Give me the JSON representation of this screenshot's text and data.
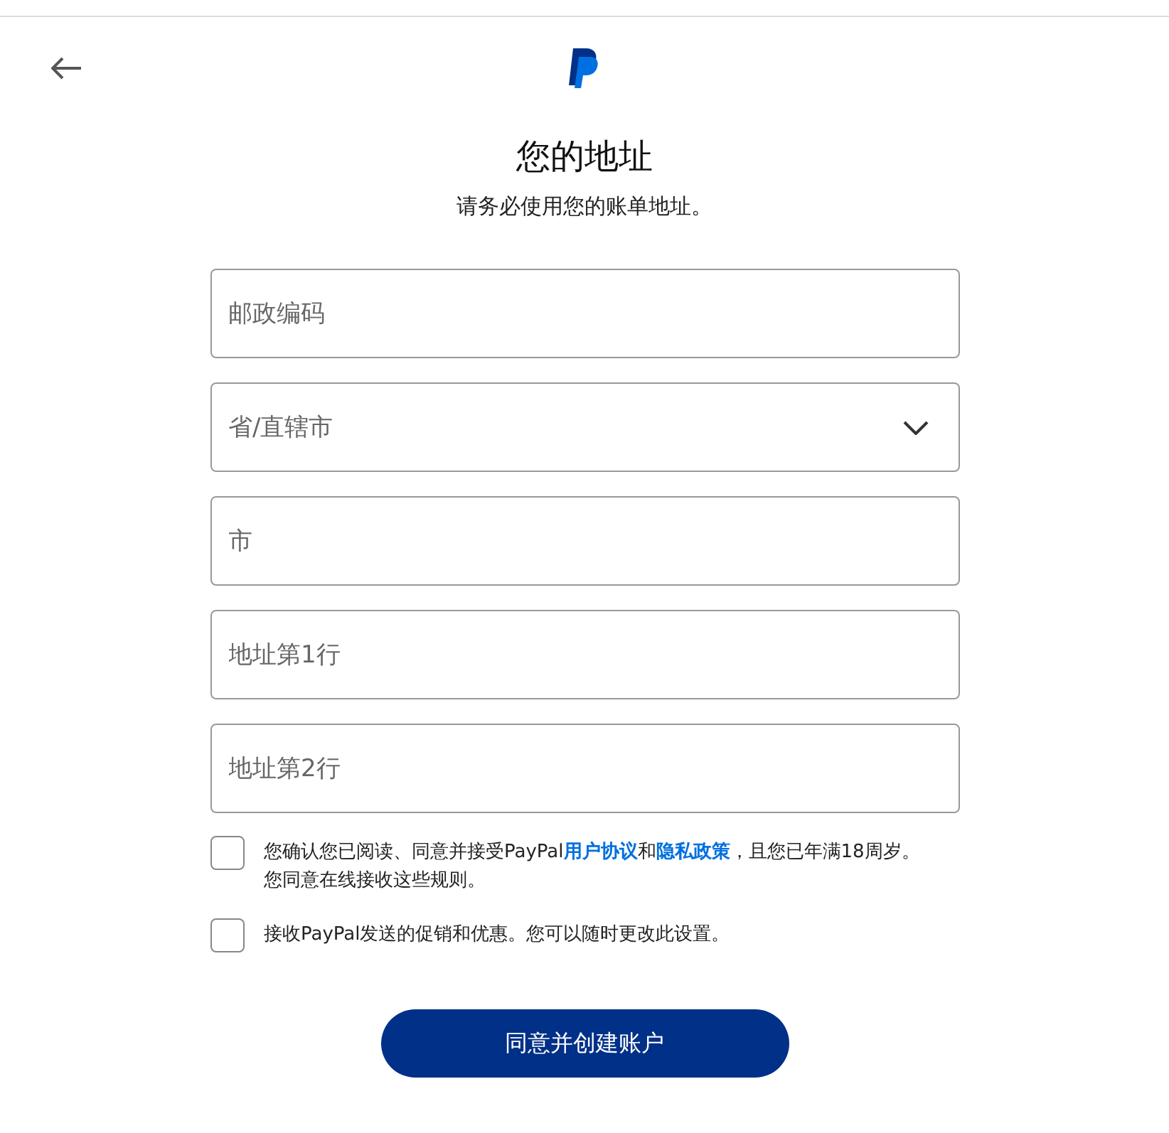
{
  "header": {
    "title": "您的地址",
    "subtitle": "请务必使用您的账单地址。"
  },
  "fields": [
    {
      "kind": "text",
      "placeholder": "邮政编码"
    },
    {
      "kind": "select",
      "placeholder": "省/直辖市"
    },
    {
      "kind": "text",
      "placeholder": "市"
    },
    {
      "kind": "text",
      "placeholder": "地址第1行"
    },
    {
      "kind": "text",
      "placeholder": "地址第2行"
    }
  ],
  "consents": [
    {
      "checked": false,
      "parts": [
        {
          "kind": "text",
          "text": "您确认您已阅读、同意并接受PayPal"
        },
        {
          "kind": "link",
          "text": "用户协议"
        },
        {
          "kind": "text",
          "text": "和"
        },
        {
          "kind": "link",
          "text": "隐私政策"
        },
        {
          "kind": "text",
          "text": "，且您已年满18周岁。您同意在线接收这些规则。"
        }
      ]
    },
    {
      "checked": false,
      "parts": [
        {
          "kind": "text",
          "text": "接收PayPal发送的促销和优惠。您可以随时更改此设置。"
        }
      ]
    }
  ],
  "submit": "同意并创建账户"
}
